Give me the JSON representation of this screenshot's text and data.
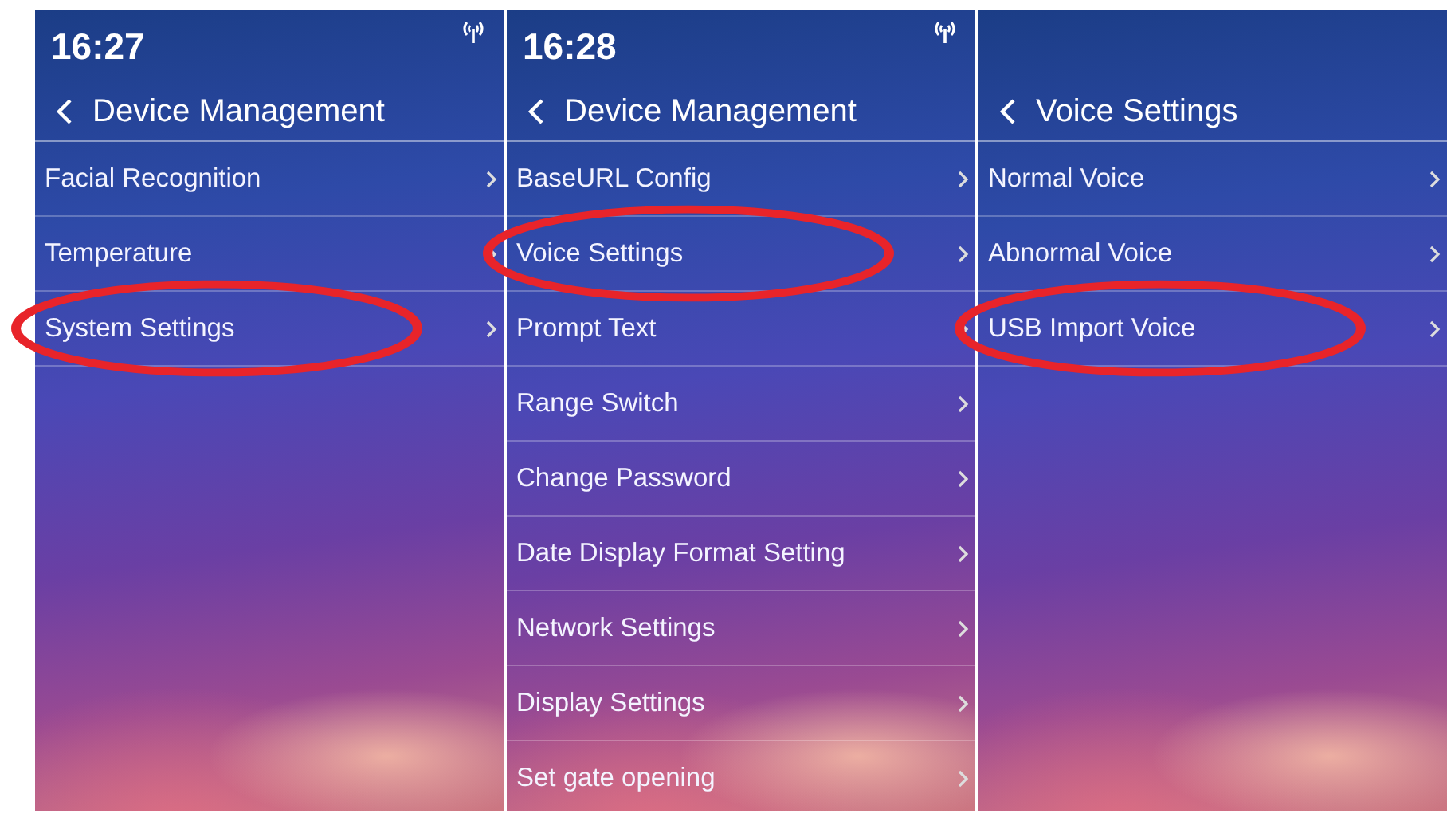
{
  "panels": [
    {
      "time": "16:27",
      "title": "Device Management",
      "items": [
        {
          "label": "Facial Recognition",
          "highlighted": false
        },
        {
          "label": "Temperature",
          "highlighted": false
        },
        {
          "label": "System Settings",
          "highlighted": true
        }
      ]
    },
    {
      "time": "16:28",
      "title": "Device Management",
      "items": [
        {
          "label": "BaseURL Config",
          "highlighted": false
        },
        {
          "label": "Voice Settings",
          "highlighted": true
        },
        {
          "label": "Prompt Text",
          "highlighted": false
        },
        {
          "label": "Range Switch",
          "highlighted": false
        },
        {
          "label": "Change Password",
          "highlighted": false
        },
        {
          "label": "Date Display Format Setting",
          "highlighted": false
        },
        {
          "label": "Network Settings",
          "highlighted": false
        },
        {
          "label": "Display Settings",
          "highlighted": false
        },
        {
          "label": "Set gate opening",
          "highlighted": false
        }
      ]
    },
    {
      "title": "Voice Settings",
      "items": [
        {
          "label": "Normal Voice",
          "highlighted": false
        },
        {
          "label": "Abnormal Voice",
          "highlighted": false
        },
        {
          "label": "USB Import Voice",
          "highlighted": true
        }
      ]
    }
  ]
}
